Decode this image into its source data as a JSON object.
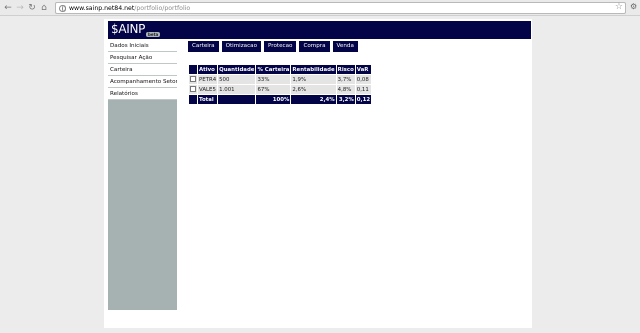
{
  "browser": {
    "url_host": "www.sainp.net84.net",
    "url_path": "/portfolio/portfolio"
  },
  "header": {
    "logo": "$AINP",
    "badge": "beta"
  },
  "sidebar": {
    "items": [
      {
        "label": "Dados Iniciais"
      },
      {
        "label": "Pesquisar Ação"
      },
      {
        "label": "Carteira"
      },
      {
        "label": "Acompanhamento Setorial"
      },
      {
        "label": "Relatórios"
      }
    ]
  },
  "tabs": [
    {
      "label": "Carteira"
    },
    {
      "label": "Otimizacao"
    },
    {
      "label": "Protecao"
    },
    {
      "label": "Compra"
    },
    {
      "label": "Venda"
    }
  ],
  "table": {
    "columns": [
      "Ativo",
      "Quantidade",
      "% Carteira",
      "Rentabilidade",
      "Risco",
      "VaR"
    ],
    "rows": [
      {
        "ativo": "PETR4",
        "quantidade": "500",
        "carteira": "33%",
        "rentabilidade": "1,9%",
        "risco": "3,7%",
        "var": "0,08"
      },
      {
        "ativo": "VALE5",
        "quantidade": "1.001",
        "carteira": "67%",
        "rentabilidade": "2,6%",
        "risco": "4,8%",
        "var": "0,11"
      }
    ],
    "total": {
      "label": "Total",
      "carteira": "100%",
      "rentabilidade": "2,4%",
      "risco": "3,2%",
      "var": "0,12"
    }
  }
}
